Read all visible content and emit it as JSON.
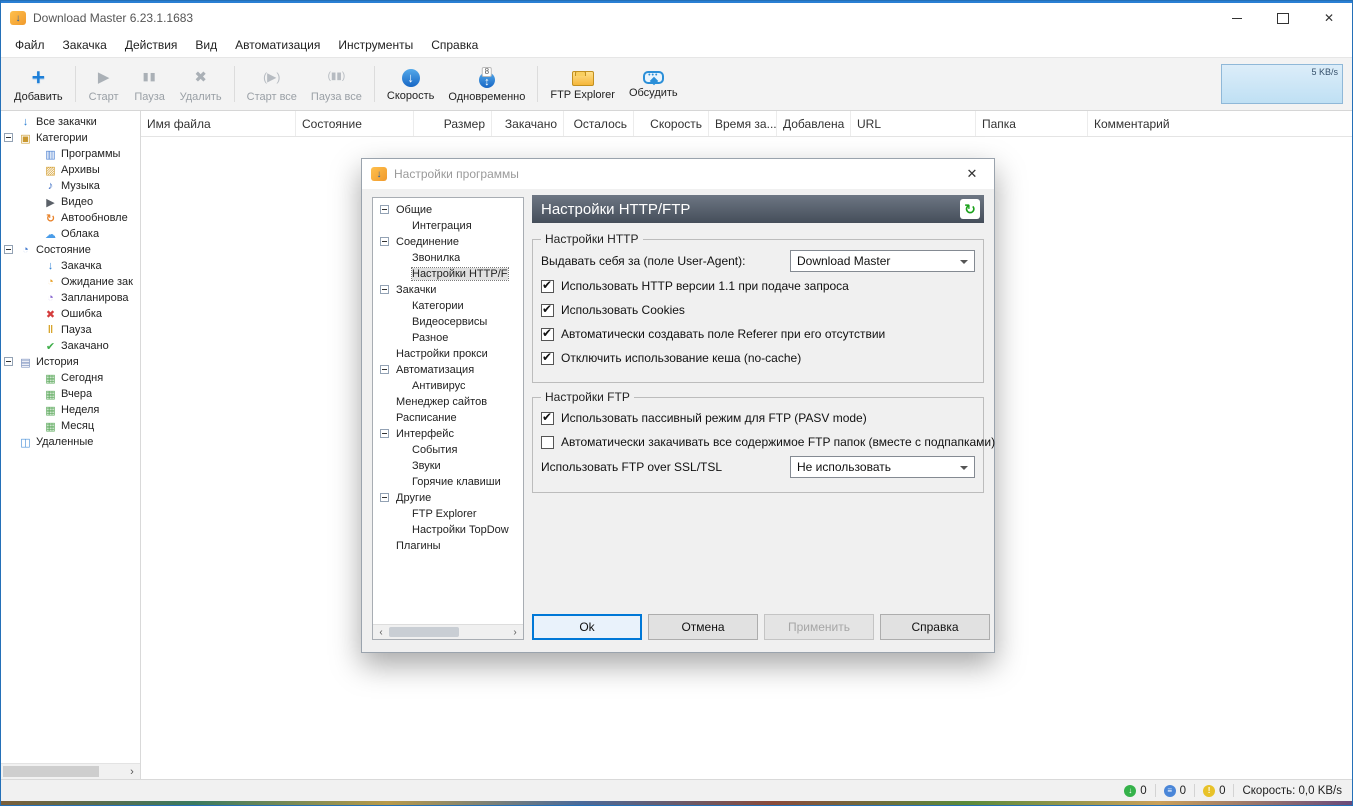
{
  "titlebar": {
    "title": "Download Master 6.23.1.1683"
  },
  "menu": {
    "items": [
      {
        "id": "file",
        "label": "Файл"
      },
      {
        "id": "downloads",
        "label": "Закачка"
      },
      {
        "id": "actions",
        "label": "Действия"
      },
      {
        "id": "view",
        "label": "Вид"
      },
      {
        "id": "automation",
        "label": "Автоматизация"
      },
      {
        "id": "tools",
        "label": "Инструменты"
      },
      {
        "id": "help",
        "label": "Справка"
      }
    ]
  },
  "toolbar": {
    "buttons": [
      {
        "id": "add",
        "label": "Добавить",
        "icon": "add-plus-icon",
        "enabled": true
      },
      {
        "id": "start",
        "label": "Старт",
        "icon": "start-icon",
        "enabled": false
      },
      {
        "id": "pause",
        "label": "Пауза",
        "icon": "pause-icon",
        "enabled": false
      },
      {
        "id": "delete",
        "label": "Удалить",
        "icon": "delete-icon",
        "enabled": false
      },
      {
        "id": "start-all",
        "label": "Старт все",
        "icon": "start-all-icon",
        "enabled": false
      },
      {
        "id": "pause-all",
        "label": "Пауза все",
        "icon": "pause-all-icon",
        "enabled": false
      },
      {
        "id": "speed",
        "label": "Скорость",
        "icon": "speed-icon",
        "enabled": true
      },
      {
        "id": "simultaneous",
        "label": "Одновременно",
        "icon": "simultaneous-icon",
        "enabled": true
      },
      {
        "id": "ftp-explorer",
        "label": "FTP Explorer",
        "icon": "ftp-folder-icon",
        "enabled": true
      },
      {
        "id": "discuss",
        "label": "Обсудить",
        "icon": "discuss-bubble-icon",
        "enabled": true
      }
    ],
    "speed_graph_label": "5 KB/s"
  },
  "columns": [
    "Имя файла",
    "Состояние",
    "Размер",
    "Закачано",
    "Осталось",
    "Скорость",
    "Время за...",
    "Добавлена",
    "URL",
    "Папка",
    "Комментарий"
  ],
  "sidebar": {
    "items": [
      {
        "label": "Все закачки",
        "depth": 0,
        "icon": "all-downloads-icon",
        "expandable": false
      },
      {
        "label": "Категории",
        "depth": 0,
        "icon": "categories-icon",
        "expandable": true
      },
      {
        "label": "Программы",
        "depth": 1,
        "icon": "programs-icon",
        "expandable": false
      },
      {
        "label": "Архивы",
        "depth": 1,
        "icon": "archives-icon",
        "expandable": false
      },
      {
        "label": "Музыка",
        "depth": 1,
        "icon": "music-icon",
        "expandable": false
      },
      {
        "label": "Видео",
        "depth": 1,
        "icon": "video-icon",
        "expandable": false
      },
      {
        "label": "Автообновле",
        "depth": 1,
        "icon": "autoupdate-icon",
        "expandable": false
      },
      {
        "label": "Облака",
        "depth": 1,
        "icon": "clouds-icon",
        "expandable": false
      },
      {
        "label": "Состояние",
        "depth": 0,
        "icon": "status-icon",
        "expandable": true
      },
      {
        "label": "Закачка",
        "depth": 1,
        "icon": "downloading-icon",
        "expandable": false
      },
      {
        "label": "Ожидание зак",
        "depth": 1,
        "icon": "waiting-icon",
        "expandable": false
      },
      {
        "label": "Запланирова",
        "depth": 1,
        "icon": "scheduled-icon",
        "expandable": false
      },
      {
        "label": "Ошибка",
        "depth": 1,
        "icon": "error-icon",
        "expandable": false
      },
      {
        "label": "Пауза",
        "depth": 1,
        "icon": "paused-icon",
        "expandable": false
      },
      {
        "label": "Закачано",
        "depth": 1,
        "icon": "completed-icon",
        "expandable": false
      },
      {
        "label": "История",
        "depth": 0,
        "icon": "history-icon",
        "expandable": true
      },
      {
        "label": "Сегодня",
        "depth": 1,
        "icon": "today-icon",
        "expandable": false
      },
      {
        "label": "Вчера",
        "depth": 1,
        "icon": "yesterday-icon",
        "expandable": false
      },
      {
        "label": "Неделя",
        "depth": 1,
        "icon": "week-icon",
        "expandable": false
      },
      {
        "label": "Месяц",
        "depth": 1,
        "icon": "month-icon",
        "expandable": false
      },
      {
        "label": "Удаленные",
        "depth": 0,
        "icon": "deleted-icon",
        "expandable": false
      }
    ]
  },
  "dialog": {
    "title": "Настройки программы",
    "header": "Настройки HTTP/FTP",
    "tree": [
      {
        "label": "Общие",
        "depth": 0,
        "expandable": true,
        "selected": false
      },
      {
        "label": "Интеграция",
        "depth": 1,
        "expandable": false,
        "selected": false
      },
      {
        "label": "Соединение",
        "depth": 0,
        "expandable": true,
        "selected": false
      },
      {
        "label": "Звонилка",
        "depth": 1,
        "expandable": false,
        "selected": false
      },
      {
        "label": "Настройки HTTP/F",
        "depth": 1,
        "expandable": false,
        "selected": true
      },
      {
        "label": "Закачки",
        "depth": 0,
        "expandable": true,
        "selected": false
      },
      {
        "label": "Категории",
        "depth": 1,
        "expandable": false,
        "selected": false
      },
      {
        "label": "Видеосервисы",
        "depth": 1,
        "expandable": false,
        "selected": false
      },
      {
        "label": "Разное",
        "depth": 1,
        "expandable": false,
        "selected": false
      },
      {
        "label": "Настройки прокси",
        "depth": 0,
        "expandable": false,
        "selected": false
      },
      {
        "label": "Автоматизация",
        "depth": 0,
        "expandable": true,
        "selected": false
      },
      {
        "label": "Антивирус",
        "depth": 1,
        "expandable": false,
        "selected": false
      },
      {
        "label": "Менеджер сайтов",
        "depth": 0,
        "expandable": false,
        "selected": false
      },
      {
        "label": "Расписание",
        "depth": 0,
        "expandable": false,
        "selected": false
      },
      {
        "label": "Интерфейс",
        "depth": 0,
        "expandable": true,
        "selected": false
      },
      {
        "label": "События",
        "depth": 1,
        "expandable": false,
        "selected": false
      },
      {
        "label": "Звуки",
        "depth": 1,
        "expandable": false,
        "selected": false
      },
      {
        "label": "Горячие клавиши",
        "depth": 1,
        "expandable": false,
        "selected": false
      },
      {
        "label": "Другие",
        "depth": 0,
        "expandable": true,
        "selected": false
      },
      {
        "label": "FTP Explorer",
        "depth": 1,
        "expandable": false,
        "selected": false
      },
      {
        "label": "Настройки TopDow",
        "depth": 1,
        "expandable": false,
        "selected": false
      },
      {
        "label": "Плагины",
        "depth": 0,
        "expandable": false,
        "selected": false
      }
    ],
    "http_group": {
      "title": "Настройки HTTP",
      "user_agent_label": "Выдавать себя за (поле User-Agent):",
      "user_agent_value": "Download Master",
      "checkboxes": [
        {
          "label": "Использовать HTTP версии 1.1 при подаче запроса",
          "checked": true
        },
        {
          "label": "Использовать Cookies",
          "checked": true
        },
        {
          "label": "Автоматически создавать поле Referer при его отсутствии",
          "checked": true
        },
        {
          "label": "Отключить использование кеша (no-cache)",
          "checked": true
        }
      ]
    },
    "ftp_group": {
      "title": "Настройки FTP",
      "checkboxes": [
        {
          "label": "Использовать пассивный режим для FTP (PASV mode)",
          "checked": true
        },
        {
          "label": "Автоматически закачивать все содержимое FTP папок (вместе с подпапками)",
          "checked": false
        }
      ],
      "ssl_label": "Использовать FTP over SSL/TSL",
      "ssl_value": "Не использовать"
    },
    "buttons": [
      {
        "id": "ok",
        "label": "Ok",
        "enabled": true,
        "default": true
      },
      {
        "id": "cancel",
        "label": "Отмена",
        "enabled": true,
        "default": false
      },
      {
        "id": "apply",
        "label": "Применить",
        "enabled": false,
        "default": false
      },
      {
        "id": "help",
        "label": "Справка",
        "enabled": true,
        "default": false
      }
    ]
  },
  "statusbar": {
    "counters": [
      {
        "icon": "green-status-icon",
        "value": "0"
      },
      {
        "icon": "blue-status-icon",
        "value": "0"
      },
      {
        "icon": "yellow-status-icon",
        "value": "0"
      }
    ],
    "speed": "Скорость: 0,0 KB/s"
  }
}
